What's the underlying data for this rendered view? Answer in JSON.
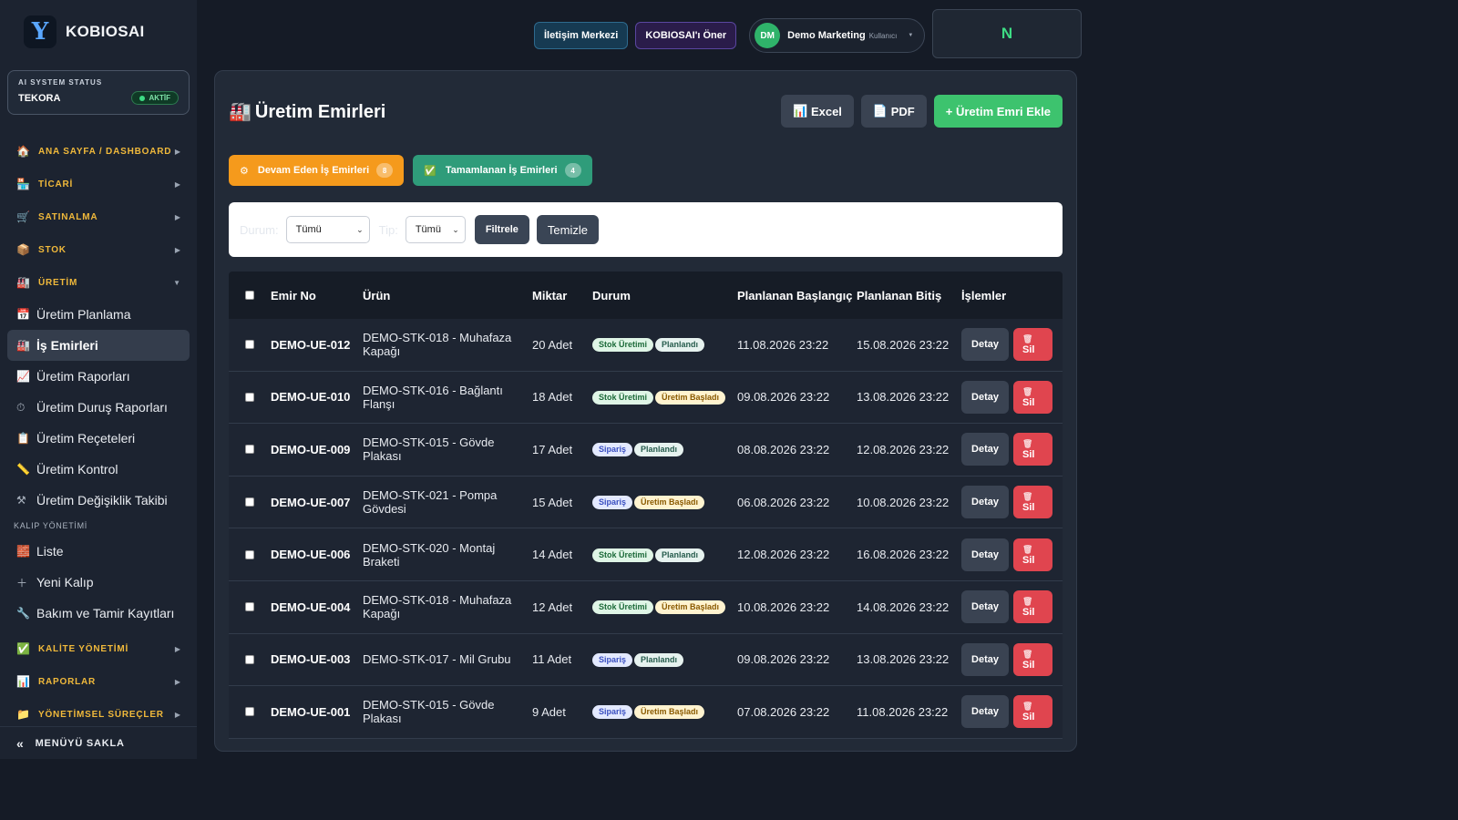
{
  "brand": {
    "logo": "Y",
    "name": "KOBIOSAI"
  },
  "ai_status": {
    "title": "AI SYSTEM STATUS",
    "name": "TEKORA",
    "badge": "AKTİF"
  },
  "nav": {
    "ana_sayfa": "ANA SAYFA / DASHBOARD",
    "ticari": "TİCARİ",
    "satinalma": "SATINALMA",
    "stok": "STOK",
    "uretim": "ÜRETİM",
    "sub": [
      "Üretim Planlama",
      "İş Emirleri",
      "Üretim Raporları",
      "Üretim Duruş Raporları",
      "Üretim Reçeteleri",
      "Üretim Kontrol",
      "Üretim Değişiklik Takibi"
    ],
    "kalip_section": "KALIP YÖNETİMİ",
    "kalip": [
      "Liste",
      "Yeni Kalıp",
      "Bakım ve Tamir Kayıtları"
    ],
    "kalite": "KALİTE YÖNETİMİ",
    "raporlar": "RAPORLAR",
    "yonetimsel": "YÖNETİMSEL SÜREÇLER",
    "hide": "MENÜYÜ SAKLA"
  },
  "topbar": {
    "contact": "İletişim Merkezi",
    "suggest": "KOBIOSAI'ı Öner",
    "avatar": "DM",
    "user_name": "Demo Marketing",
    "user_role": "Kullanıcı",
    "n_box": "N"
  },
  "page": {
    "title": "Üretim Emirleri",
    "excel": "Excel",
    "pdf": "PDF",
    "add": "Üretim Emri Ekle"
  },
  "tabs": {
    "ongoing": {
      "label": "Devam Eden İş Emirleri",
      "count": "8"
    },
    "done": {
      "label": "Tamamlanan İş Emirleri",
      "count": "4"
    }
  },
  "filter": {
    "durum_label": "Durum:",
    "durum_value": "Tümü",
    "tip_label": "Tip:",
    "tip_value": "Tümü",
    "filter_btn": "Filtrele",
    "clear_btn": "Temizle"
  },
  "table": {
    "headers": {
      "no": "Emir No",
      "product": "Ürün",
      "qty": "Miktar",
      "status": "Durum",
      "start": "Planlanan Başlangıç",
      "end": "Planlanan Bitiş",
      "actions": "İşlemler"
    },
    "detail_label": "Detay",
    "delete_label": "Sil",
    "rows": [
      {
        "no": "DEMO-UE-012",
        "product": "DEMO-STK-018 - Muhafaza Kapağı",
        "qty": "20 Adet",
        "type": "Stok Üretimi",
        "status": "Planlandı",
        "start": "11.08.2026 23:22",
        "end": "15.08.2026 23:22"
      },
      {
        "no": "DEMO-UE-010",
        "product": "DEMO-STK-016 - Bağlantı Flanşı",
        "qty": "18 Adet",
        "type": "Stok Üretimi",
        "status": "Üretim Başladı",
        "start": "09.08.2026 23:22",
        "end": "13.08.2026 23:22"
      },
      {
        "no": "DEMO-UE-009",
        "product": "DEMO-STK-015 - Gövde Plakası",
        "qty": "17 Adet",
        "type": "Sipariş",
        "status": "Planlandı",
        "start": "08.08.2026 23:22",
        "end": "12.08.2026 23:22"
      },
      {
        "no": "DEMO-UE-007",
        "product": "DEMO-STK-021 - Pompa Gövdesi",
        "qty": "15 Adet",
        "type": "Sipariş",
        "status": "Üretim Başladı",
        "start": "06.08.2026 23:22",
        "end": "10.08.2026 23:22"
      },
      {
        "no": "DEMO-UE-006",
        "product": "DEMO-STK-020 - Montaj Braketi",
        "qty": "14 Adet",
        "type": "Stok Üretimi",
        "status": "Planlandı",
        "start": "12.08.2026 23:22",
        "end": "16.08.2026 23:22"
      },
      {
        "no": "DEMO-UE-004",
        "product": "DEMO-STK-018 - Muhafaza Kapağı",
        "qty": "12 Adet",
        "type": "Stok Üretimi",
        "status": "Üretim Başladı",
        "start": "10.08.2026 23:22",
        "end": "14.08.2026 23:22"
      },
      {
        "no": "DEMO-UE-003",
        "product": "DEMO-STK-017 - Mil Grubu",
        "qty": "11 Adet",
        "type": "Sipariş",
        "status": "Planlandı",
        "start": "09.08.2026 23:22",
        "end": "13.08.2026 23:22"
      },
      {
        "no": "DEMO-UE-001",
        "product": "DEMO-STK-015 - Gövde Plakası",
        "qty": "9 Adet",
        "type": "Sipariş",
        "status": "Üretim Başladı",
        "start": "07.08.2026 23:22",
        "end": "11.08.2026 23:22"
      }
    ]
  }
}
